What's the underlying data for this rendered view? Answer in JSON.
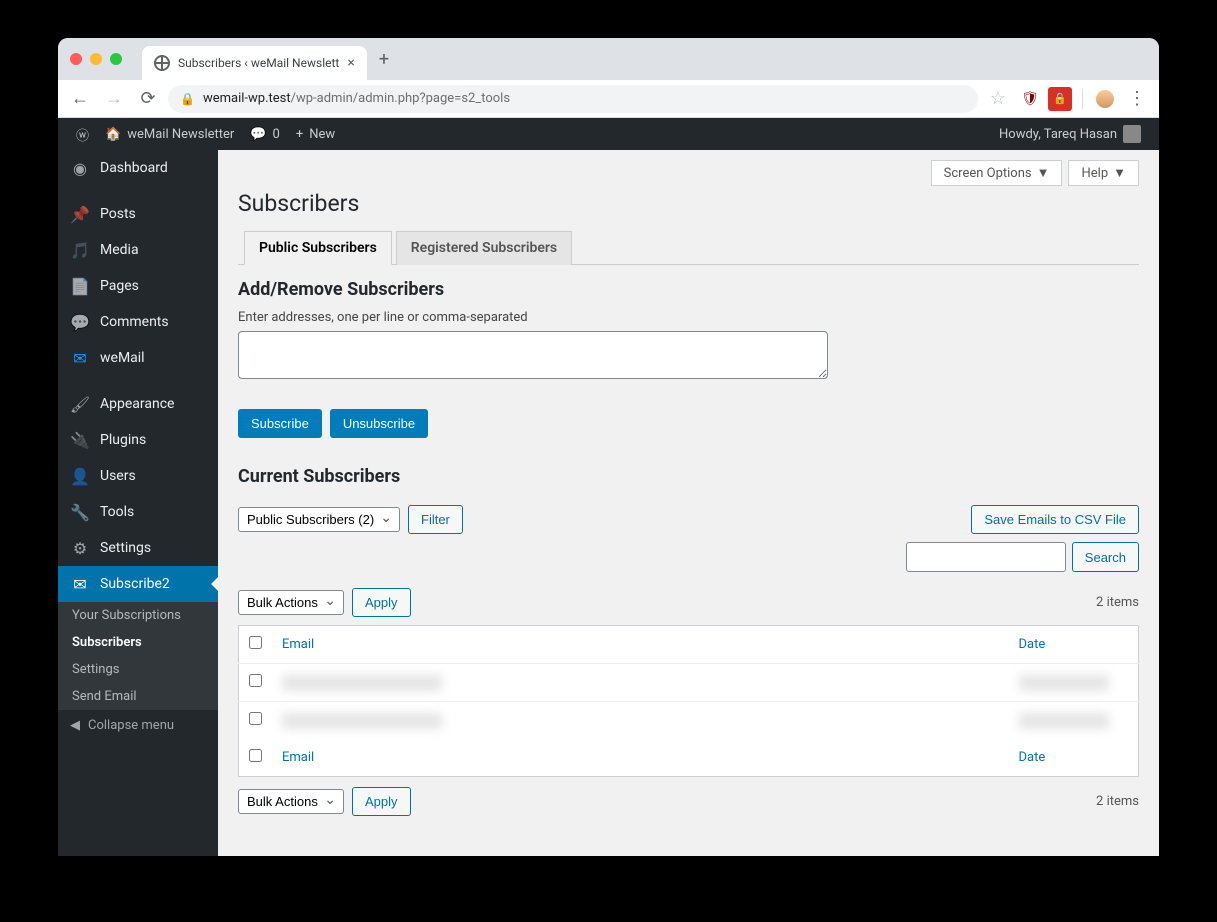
{
  "browser": {
    "tab_title": "Subscribers ‹ weMail Newslett",
    "url_host": "wemail-wp.test",
    "url_path": "/wp-admin/admin.php?page=s2_tools"
  },
  "admin_bar": {
    "site_title": "weMail Newsletter",
    "comments_count": "0",
    "new_label": "New",
    "howdy": "Howdy, Tareq Hasan"
  },
  "sidebar": {
    "items": [
      {
        "label": "Dashboard"
      },
      {
        "label": "Posts"
      },
      {
        "label": "Media"
      },
      {
        "label": "Pages"
      },
      {
        "label": "Comments"
      },
      {
        "label": "weMail"
      },
      {
        "label": "Appearance"
      },
      {
        "label": "Plugins"
      },
      {
        "label": "Users"
      },
      {
        "label": "Tools"
      },
      {
        "label": "Settings"
      },
      {
        "label": "Subscribe2"
      }
    ],
    "submenu": [
      {
        "label": "Your Subscriptions"
      },
      {
        "label": "Subscribers"
      },
      {
        "label": "Settings"
      },
      {
        "label": "Send Email"
      }
    ],
    "collapse": "Collapse menu"
  },
  "screen_meta": {
    "screen_options": "Screen Options",
    "help": "Help"
  },
  "page": {
    "title": "Subscribers",
    "tabs": [
      {
        "label": "Public Subscribers",
        "active": true
      },
      {
        "label": "Registered Subscribers",
        "active": false
      }
    ],
    "add_remove_heading": "Add/Remove Subscribers",
    "hint": "Enter addresses, one per line or comma-separated",
    "subscribe_btn": "Subscribe",
    "unsubscribe_btn": "Unsubscribe",
    "current_heading": "Current Subscribers",
    "filter_select": "Public Subscribers (2)",
    "filter_btn": "Filter",
    "save_csv": "Save Emails to CSV File",
    "search_btn": "Search",
    "bulk_select": "Bulk Actions",
    "apply_btn": "Apply",
    "items_count": "2 items",
    "col_email": "Email",
    "col_date": "Date"
  }
}
